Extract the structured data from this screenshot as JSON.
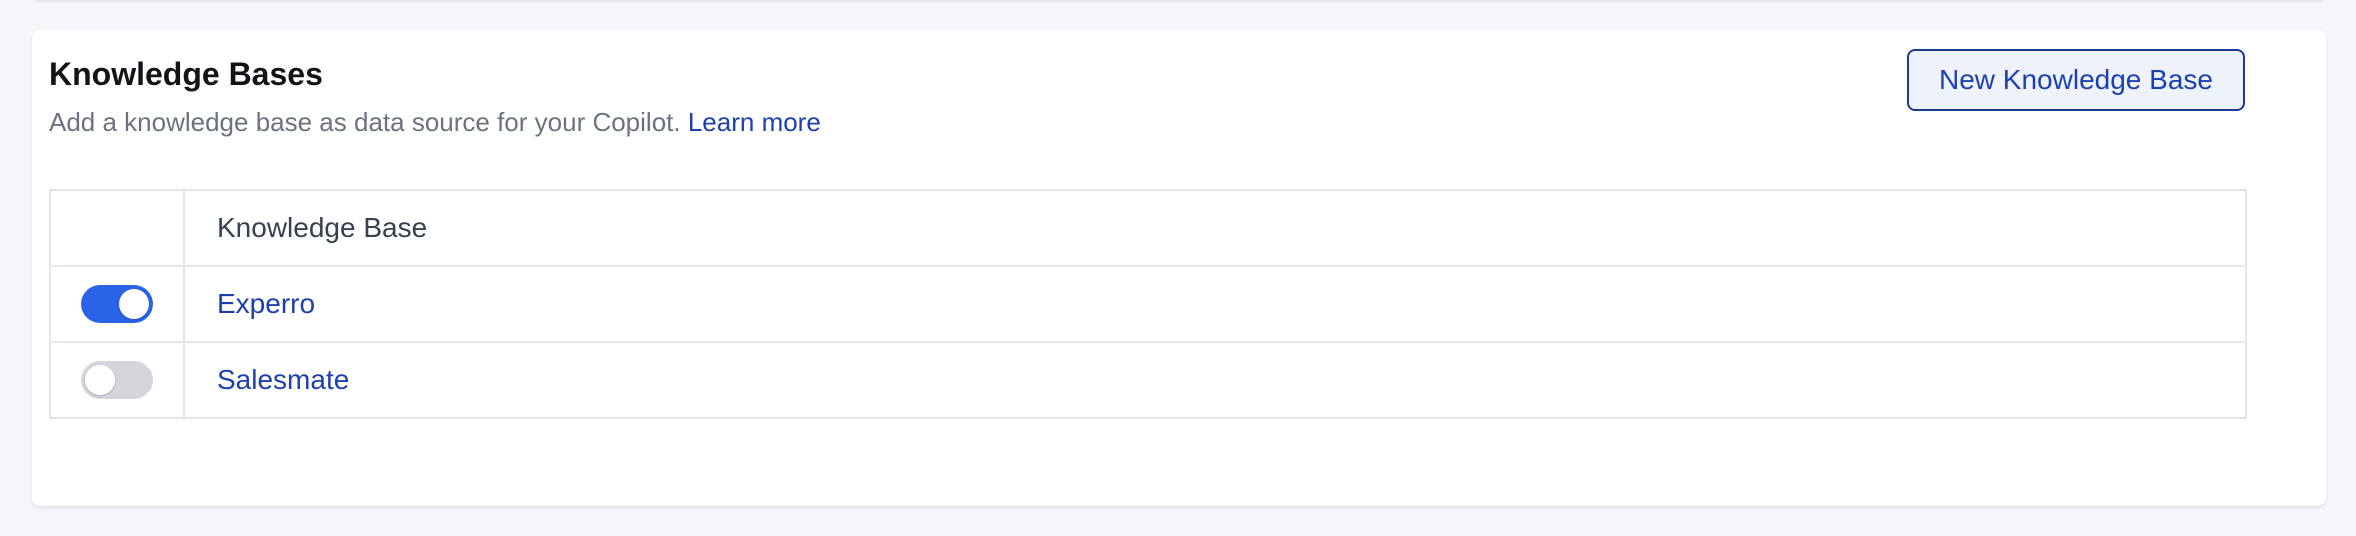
{
  "section": {
    "title": "Knowledge Bases",
    "description": "Add a knowledge base as data source for your Copilot.",
    "learn_more_label": "Learn more",
    "new_button_label": "New Knowledge Base"
  },
  "table": {
    "columns": [
      "",
      "Knowledge Base"
    ],
    "rows": [
      {
        "name": "Experro",
        "enabled": true
      },
      {
        "name": "Salesmate",
        "enabled": false
      }
    ]
  },
  "colors": {
    "accent": "#2b63e8",
    "link": "#1e40af",
    "toggle_off": "#d4d6db"
  }
}
